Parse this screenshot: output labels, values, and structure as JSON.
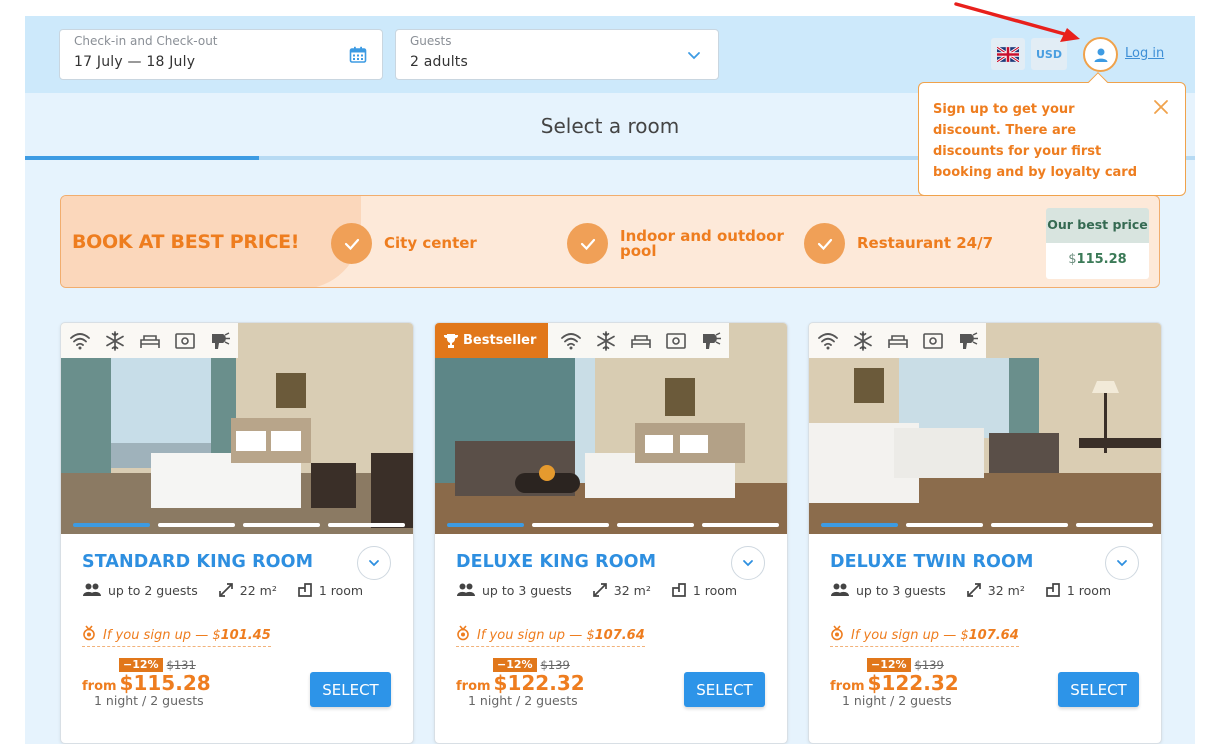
{
  "search": {
    "dates": {
      "label": "Check-in and Check-out",
      "value": "17 July — 18 July",
      "icon": "calendar-icon"
    },
    "guests": {
      "label": "Guests",
      "value": "2 adults",
      "icon": "chevron-down-icon"
    }
  },
  "header": {
    "language_icon": "uk-flag-icon",
    "currency": "USD",
    "login_label": "Log in"
  },
  "step": {
    "title": "Select a room"
  },
  "banner": {
    "headline": "BOOK AT BEST PRICE!",
    "features": [
      "City center",
      "Indoor and outdoor pool",
      "Restaurant 24/7"
    ],
    "best_price_label": "Our best price",
    "best_price_currency": "$",
    "best_price_value": "115.28"
  },
  "popup": {
    "text": "Sign up to get your discount. There are discounts for your first booking and by loyalty card"
  },
  "rooms": [
    {
      "name": "STANDARD KING ROOM",
      "badge": "",
      "guests": "up to 2 guests",
      "area": "22 m²",
      "rooms": "1 room",
      "signup_prefix": "If you sign up — $",
      "signup_price": "101.45",
      "discount": "−12%",
      "old_price": "$131",
      "from": "from",
      "currency": "$",
      "price": "115.28",
      "per": "1 night / 2 guests",
      "select": "SELECT"
    },
    {
      "name": "DELUXE KING ROOM",
      "badge": "Bestseller",
      "guests": "up to 3 guests",
      "area": "32 m²",
      "rooms": "1 room",
      "signup_prefix": "If you sign up — $",
      "signup_price": "107.64",
      "discount": "−12%",
      "old_price": "$139",
      "from": "from",
      "currency": "$",
      "price": "122.32",
      "per": "1 night / 2 guests",
      "select": "SELECT"
    },
    {
      "name": "DELUXE TWIN ROOM",
      "badge": "",
      "guests": "up to 3 guests",
      "area": "32 m²",
      "rooms": "1 room",
      "signup_prefix": "If you sign up — $",
      "signup_price": "107.64",
      "discount": "−12%",
      "old_price": "$139",
      "from": "from",
      "currency": "$",
      "price": "122.32",
      "per": "1 night / 2 guests",
      "select": "SELECT"
    }
  ],
  "amenity_icons": [
    "wifi-icon",
    "snowflake-icon",
    "bed-icon",
    "safe-icon",
    "hairdryer-icon"
  ],
  "colors": {
    "accent_blue": "#2d94e8",
    "accent_orange": "#ee7d1f",
    "bestseller": "#e1771a"
  }
}
